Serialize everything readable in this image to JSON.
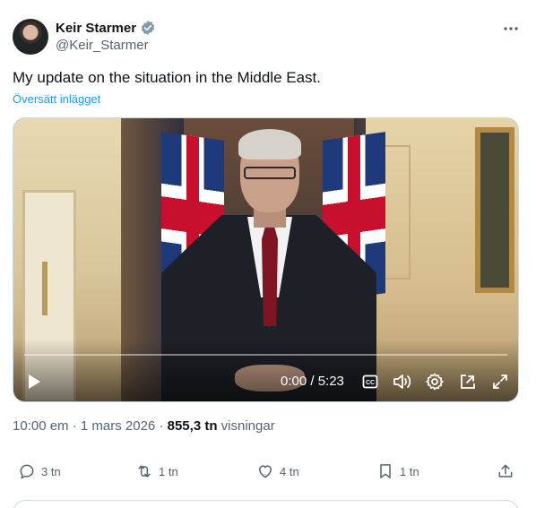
{
  "author": {
    "name": "Keir Starmer",
    "handle": "@Keir_Starmer",
    "verified_icon": "verified-badge-icon"
  },
  "post": {
    "text": "My update on the situation in the Middle East.",
    "translate_label": "Översätt inlägget"
  },
  "video": {
    "time_display": "0:00 / 5:23",
    "progress_fraction": 0,
    "controls": [
      "play-icon",
      "captions-icon",
      "volume-icon",
      "settings-icon",
      "pop-out-icon",
      "fullscreen-icon"
    ]
  },
  "meta": {
    "time": "10:00 em",
    "separator1": " · ",
    "date": "1 mars 2026",
    "separator2": " · ",
    "views_count": "855,3 tn",
    "views_label": " visningar"
  },
  "actions": {
    "replies": "3 tn",
    "reposts": "1 tn",
    "likes": "4 tn",
    "bookmarks": "1 tn"
  },
  "colors": {
    "accent": "#1d9bf0",
    "text_primary": "#0f1419",
    "text_secondary": "#536471",
    "border": "#cfd9de"
  }
}
